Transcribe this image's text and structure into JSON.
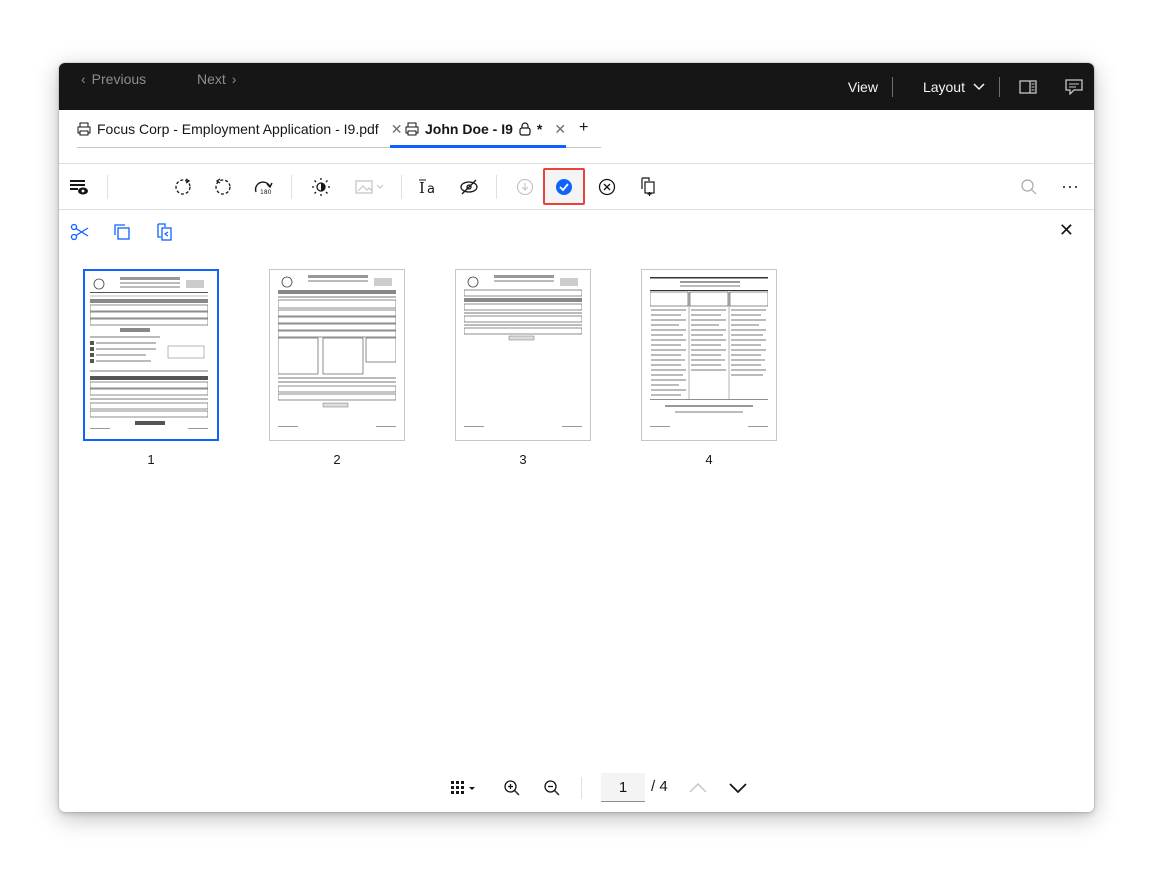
{
  "topbar": {
    "prev_label": "Previous",
    "next_label": "Next",
    "view_label": "View",
    "layout_label": "Layout"
  },
  "tabs": [
    {
      "label": "Focus Corp - Employment Application - I9.pdf",
      "active": false
    },
    {
      "label": "John Doe - I9",
      "modified_marker": "*",
      "active": true
    }
  ],
  "toolbar": {
    "items": [
      "annotation-view-icon",
      "rotate-clockwise-icon",
      "rotate-counterclockwise-icon",
      "rotate-180-icon",
      "brightness-icon",
      "image-adjust-icon",
      "ocr-text-icon",
      "hide-icon",
      "download-icon",
      "apply-checkmark-icon",
      "cancel-icon",
      "insert-page-icon",
      "search-icon",
      "overflow-menu-icon"
    ]
  },
  "subtoolbar": {
    "items": [
      "split-icon",
      "copy-icon",
      "paste-icon",
      "close-icon"
    ]
  },
  "thumbnails": [
    {
      "page": "1",
      "selected": true
    },
    {
      "page": "2",
      "selected": false
    },
    {
      "page": "3",
      "selected": false
    },
    {
      "page": "4",
      "selected": false
    }
  ],
  "pager": {
    "current": "1",
    "total": "/ 4"
  },
  "colors": {
    "accent": "#0f62fe",
    "topbar": "#161616",
    "highlight": "#e5443e"
  }
}
